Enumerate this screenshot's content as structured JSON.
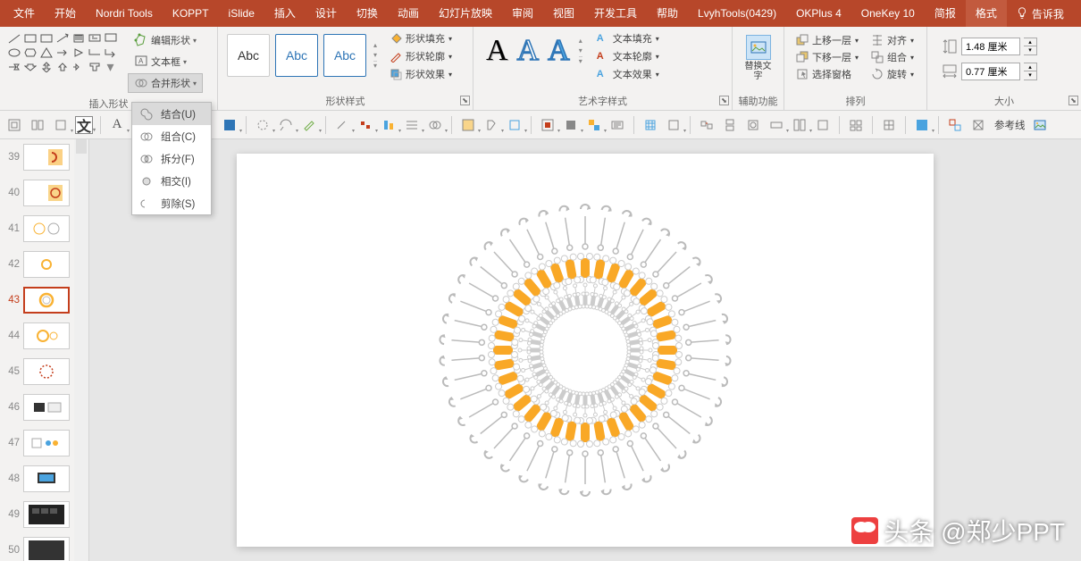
{
  "tabs": {
    "items": [
      "文件",
      "开始",
      "Nordri Tools",
      "KOPPT",
      "iSlide",
      "插入",
      "设计",
      "切换",
      "动画",
      "幻灯片放映",
      "审阅",
      "视图",
      "开发工具",
      "帮助",
      "LvyhTools(0429)",
      "OKPlus 4",
      "OneKey 10",
      "简报",
      "格式"
    ],
    "active_index": 18,
    "tell_me": "告诉我"
  },
  "ribbon": {
    "insert_shapes": {
      "label": "插入形状",
      "edit_shape": "编辑形状",
      "text_box": "文本框",
      "merge_shapes": "合并形状"
    },
    "shape_styles": {
      "label": "形状样式",
      "sample": "Abc",
      "fill": "形状填充",
      "outline": "形状轮廓",
      "effects": "形状效果"
    },
    "wordart_styles": {
      "label": "艺术字样式",
      "text_fill": "文本填充",
      "text_outline": "文本轮廓",
      "text_effects": "文本效果"
    },
    "aux": {
      "label": "辅助功能",
      "alt_text": "替换文字"
    },
    "arrange": {
      "label": "排列",
      "bring_forward": "上移一层",
      "send_backward": "下移一层",
      "selection_pane": "选择窗格",
      "align": "对齐",
      "group": "组合",
      "rotate": "旋转"
    },
    "size": {
      "label": "大小",
      "height": "1.48 厘米",
      "width": "0.77 厘米"
    }
  },
  "toolbar2": {
    "guides": "参考线"
  },
  "merge_menu": {
    "items": [
      {
        "label": "结合(U)",
        "icon": "union"
      },
      {
        "label": "组合(C)",
        "icon": "combine"
      },
      {
        "label": "拆分(F)",
        "icon": "fragment"
      },
      {
        "label": "相交(I)",
        "icon": "intersect"
      },
      {
        "label": "剪除(S)",
        "icon": "subtract"
      }
    ],
    "hover_index": 0
  },
  "thumbnails": {
    "items": [
      39,
      40,
      41,
      42,
      43,
      44,
      45,
      46,
      47,
      48,
      49,
      50
    ],
    "selected": 43
  },
  "watermark": "头条 @郑少PPT"
}
